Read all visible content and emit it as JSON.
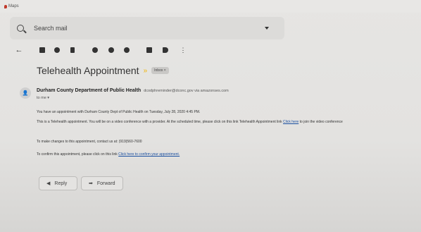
{
  "window": {
    "app_label": "Maps"
  },
  "search": {
    "placeholder": "Search mail"
  },
  "email": {
    "subject": "Telehealth Appointment",
    "label": "Inbox ×",
    "sender_name": "Durham County Department of Public Health",
    "sender_addr": "dcodphreminder@dconc.gov via amazonses.com",
    "to": "to me ▾",
    "p1": "You have an appointment with Durham County Dept of Public Health on Tuesday, July 28, 2020 4:45 PM.",
    "p2_pre": "This is a Telehealth appointment. You will be on a video conference with a provider. At the scheduled time, please click on this link Telehealth Appointment link ",
    "p2_link": "Click here",
    "p2_post": " to join the video conference",
    "p3": "To make changes to this appointment, contact us at: (919)560-7600",
    "p4_pre": "To confirm this appointment, please click on this link ",
    "p4_link": "Click here to confirm your appointment."
  },
  "actions": {
    "reply": "Reply",
    "forward": "Forward"
  },
  "colors": {
    "link": "#1a4fa0",
    "accent": "#f3b400"
  }
}
